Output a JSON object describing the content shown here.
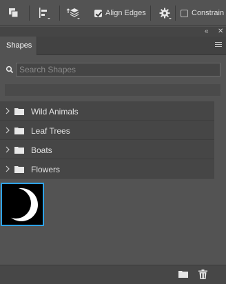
{
  "toolbar": {
    "align_edges_label": "Align Edges",
    "align_edges_checked": true,
    "constrain_label": "Constrain P",
    "constrain_checked": false
  },
  "panel": {
    "tab_label": "Shapes"
  },
  "search": {
    "placeholder": "Search Shapes",
    "value": ""
  },
  "groups": [
    {
      "label": "Wild Animals"
    },
    {
      "label": "Leaf Trees"
    },
    {
      "label": "Boats"
    },
    {
      "label": "Flowers"
    }
  ],
  "selected_shape": "crescent-moon",
  "colors": {
    "selection": "#2ea3e8",
    "panel_bg": "#535353"
  }
}
